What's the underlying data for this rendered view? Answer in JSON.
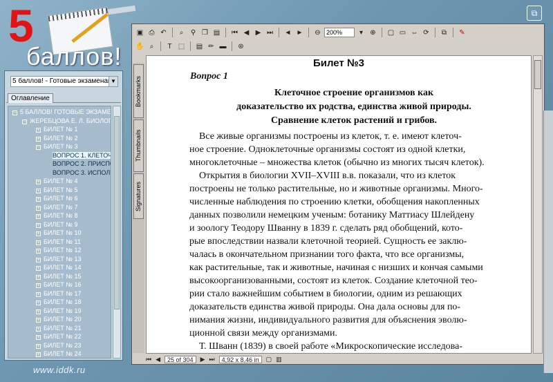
{
  "logo": {
    "number": "5",
    "word": "баллов!"
  },
  "footer": {
    "url": "www.iddk.ru"
  },
  "left": {
    "combo_value": "5 баллов! - Готовые экзаменацион",
    "tab": "Оглавление",
    "tree": [
      {
        "label": "5 БАЛЛОВ! ГОТОВЫЕ ЭКЗАМЕНА",
        "level": 0,
        "pm": "−"
      },
      {
        "label": "ЖЕРЕБЦОВА Е. Л. БИОЛОГИ",
        "level": 1,
        "pm": "−"
      },
      {
        "label": "БИЛЕТ № 1",
        "level": 2,
        "pm": "+"
      },
      {
        "label": "БИЛЕТ № 2",
        "level": 2,
        "pm": "+"
      },
      {
        "label": "БИЛЕТ № 3",
        "level": 2,
        "pm": "−"
      },
      {
        "label": "ВОПРОС 1. КЛЕТОЧНО",
        "level": 3,
        "pm": "",
        "selected": true
      },
      {
        "label": "ВОПРОС 2. ПРИСПОСО",
        "level": 3,
        "pm": ""
      },
      {
        "label": "ВОПРОС 3. ИСПОЛЬЗО",
        "level": 3,
        "pm": ""
      },
      {
        "label": "БИЛЕТ № 4",
        "level": 2,
        "pm": "+"
      },
      {
        "label": "БИЛЕТ № 5",
        "level": 2,
        "pm": "+"
      },
      {
        "label": "БИЛЕТ № 6",
        "level": 2,
        "pm": "+"
      },
      {
        "label": "БИЛЕТ № 7",
        "level": 2,
        "pm": "+"
      },
      {
        "label": "БИЛЕТ № 8",
        "level": 2,
        "pm": "+"
      },
      {
        "label": "БИЛЕТ № 9",
        "level": 2,
        "pm": "+"
      },
      {
        "label": "БИЛЕТ № 10",
        "level": 2,
        "pm": "+"
      },
      {
        "label": "БИЛЕТ № 11",
        "level": 2,
        "pm": "+"
      },
      {
        "label": "БИЛЕТ № 12",
        "level": 2,
        "pm": "+"
      },
      {
        "label": "БИЛЕТ № 13",
        "level": 2,
        "pm": "+"
      },
      {
        "label": "БИЛЕТ № 14",
        "level": 2,
        "pm": "+"
      },
      {
        "label": "БИЛЕТ № 15",
        "level": 2,
        "pm": "+"
      },
      {
        "label": "БИЛЕТ № 16",
        "level": 2,
        "pm": "+"
      },
      {
        "label": "БИЛЕТ № 17",
        "level": 2,
        "pm": "+"
      },
      {
        "label": "БИЛЕТ № 18",
        "level": 2,
        "pm": "+"
      },
      {
        "label": "БИЛЕТ № 19",
        "level": 2,
        "pm": "+"
      },
      {
        "label": "БИЛЕТ № 20",
        "level": 2,
        "pm": "+"
      },
      {
        "label": "БИЛЕТ № 21",
        "level": 2,
        "pm": "+"
      },
      {
        "label": "БИЛЕТ № 22",
        "level": 2,
        "pm": "+"
      },
      {
        "label": "БИЛЕТ № 23",
        "level": 2,
        "pm": "+"
      },
      {
        "label": "БИЛЕТ № 24",
        "level": 2,
        "pm": "+"
      }
    ]
  },
  "viewer": {
    "zoom": "200%",
    "side_tabs": [
      "Bookmarks",
      "Thumbnails",
      "Signatures"
    ],
    "page_indicator": "25 of 304",
    "page_size": "4,92 x 8,46 in",
    "document": {
      "header": "Билет №3",
      "question": "Вопрос 1",
      "title_lines": [
        "Клеточное строение организмов как",
        "доказательство их родства, единства живой природы.",
        "Сравнение клеток растений и грибов."
      ],
      "body_lines": [
        "    Все живые организмы построены из клеток, т. е. имеют клеточ-",
        "ное строение. Одноклеточные организмы состоят из одной клетки,",
        "многоклеточные – множества клеток (обычно из многих тысяч клеток).",
        "    Открытия в биологии XVII–XVIII в.в. показали, что из клеток",
        "построены не только растительные, но и животные организмы. Много-",
        "численные наблюдения по строению клетки, обобщения накопленных",
        "данных позволили немецким ученым: ботанику Маттиасу Шлейдену",
        "и зоологу Теодору Шванну в 1839 г. сделать ряд обобщений, кото-",
        "рые впоследствии назвали клеточной теорией. Сущность ее заклю-",
        "чалась в окончательном признании того факта, что все организмы,",
        "как растительные, так и животные, начиная с низших и кончая самыми",
        "высокоорганизованными, состоят из клеток. Создание клеточной тео-",
        "рии стало важнейшим событием в биологии, одним из решающих",
        "доказательств единства живой природы. Она дала основы для по-",
        "нимания жизни, индивидуального развития для объяснения эволю-",
        "ционной связи между организмами.",
        "    Т. Шванн (1839) в своей работе «Микроскопические исследова-"
      ]
    }
  }
}
